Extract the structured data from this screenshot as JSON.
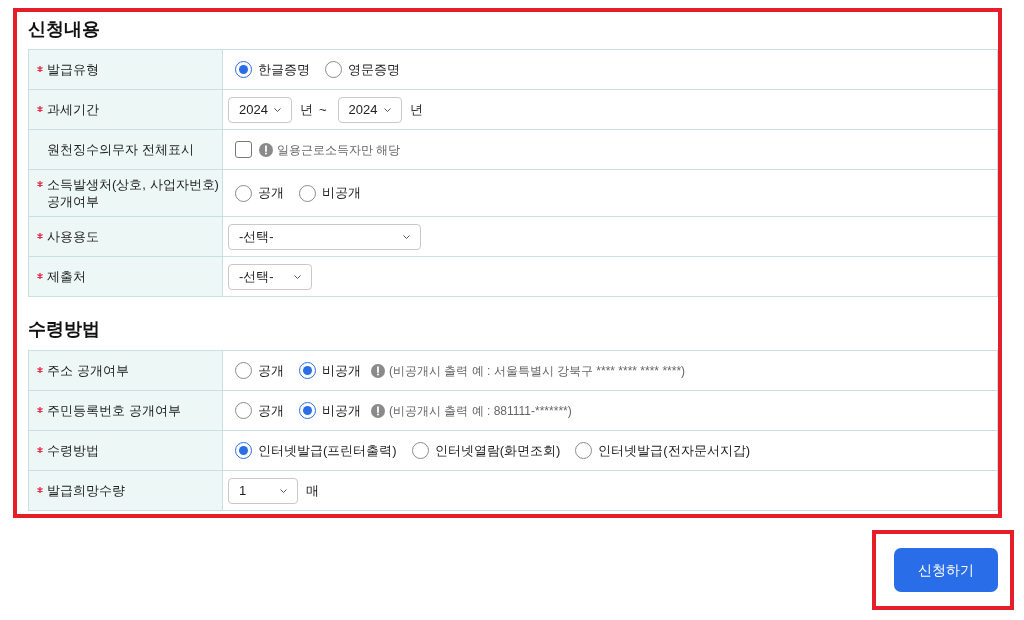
{
  "sections": [
    {
      "title": "신청내용",
      "rows": [
        {
          "label": "발급유형",
          "required": true,
          "items": [
            {
              "kind": "radio",
              "label": "한글증명",
              "selected": true
            },
            {
              "kind": "radio",
              "label": "영문증명",
              "selected": false
            }
          ]
        },
        {
          "label": "과세기간",
          "required": true,
          "items": [
            {
              "kind": "select",
              "value": "2024"
            },
            {
              "kind": "unit",
              "text": "년"
            },
            {
              "kind": "separator",
              "text": "~"
            },
            {
              "kind": "select",
              "value": "2024"
            },
            {
              "kind": "unit",
              "text": "년"
            }
          ]
        },
        {
          "label": "원천징수의무자 전체표시",
          "required": false,
          "items": [
            {
              "kind": "checkbox",
              "checked": false
            },
            {
              "kind": "note",
              "text": "일용근로소득자만 해당"
            }
          ]
        },
        {
          "label": "소득발생처(상호, 사업자번호) 공개여부",
          "required": true,
          "items": [
            {
              "kind": "radio",
              "label": "공개",
              "selected": false
            },
            {
              "kind": "radio",
              "label": "비공개",
              "selected": false
            }
          ]
        },
        {
          "label": "사용용도",
          "required": true,
          "items": [
            {
              "kind": "select",
              "value": "-선택-"
            }
          ]
        },
        {
          "label": "제출처",
          "required": true,
          "items": [
            {
              "kind": "select",
              "value": "-선택-"
            }
          ]
        }
      ]
    },
    {
      "title": "수령방법",
      "rows": [
        {
          "label": "주소 공개여부",
          "required": true,
          "items": [
            {
              "kind": "radio",
              "label": "공개",
              "selected": false
            },
            {
              "kind": "radio",
              "label": "비공개",
              "selected": true
            },
            {
              "kind": "note",
              "text": "(비공개시 출력 예 : 서울특별시 강북구 **** **** **** ****)"
            }
          ]
        },
        {
          "label": "주민등록번호 공개여부",
          "required": true,
          "items": [
            {
              "kind": "radio",
              "label": "공개",
              "selected": false
            },
            {
              "kind": "radio",
              "label": "비공개",
              "selected": true
            },
            {
              "kind": "note",
              "text": "(비공개시 출력 예 : 881111-*******)"
            }
          ]
        },
        {
          "label": "수령방법",
          "required": true,
          "items": [
            {
              "kind": "radio",
              "label": "인터넷발급(프린터출력)",
              "selected": true
            },
            {
              "kind": "radio",
              "label": "인터넷열람(화면조회)",
              "selected": false
            },
            {
              "kind": "radio",
              "label": "인터넷발급(전자문서지갑)",
              "selected": false
            }
          ]
        },
        {
          "label": "발급희망수량",
          "required": true,
          "items": [
            {
              "kind": "select",
              "value": "1"
            },
            {
              "kind": "unit",
              "text": "매"
            }
          ]
        }
      ]
    }
  ],
  "submit_button": "신청하기"
}
